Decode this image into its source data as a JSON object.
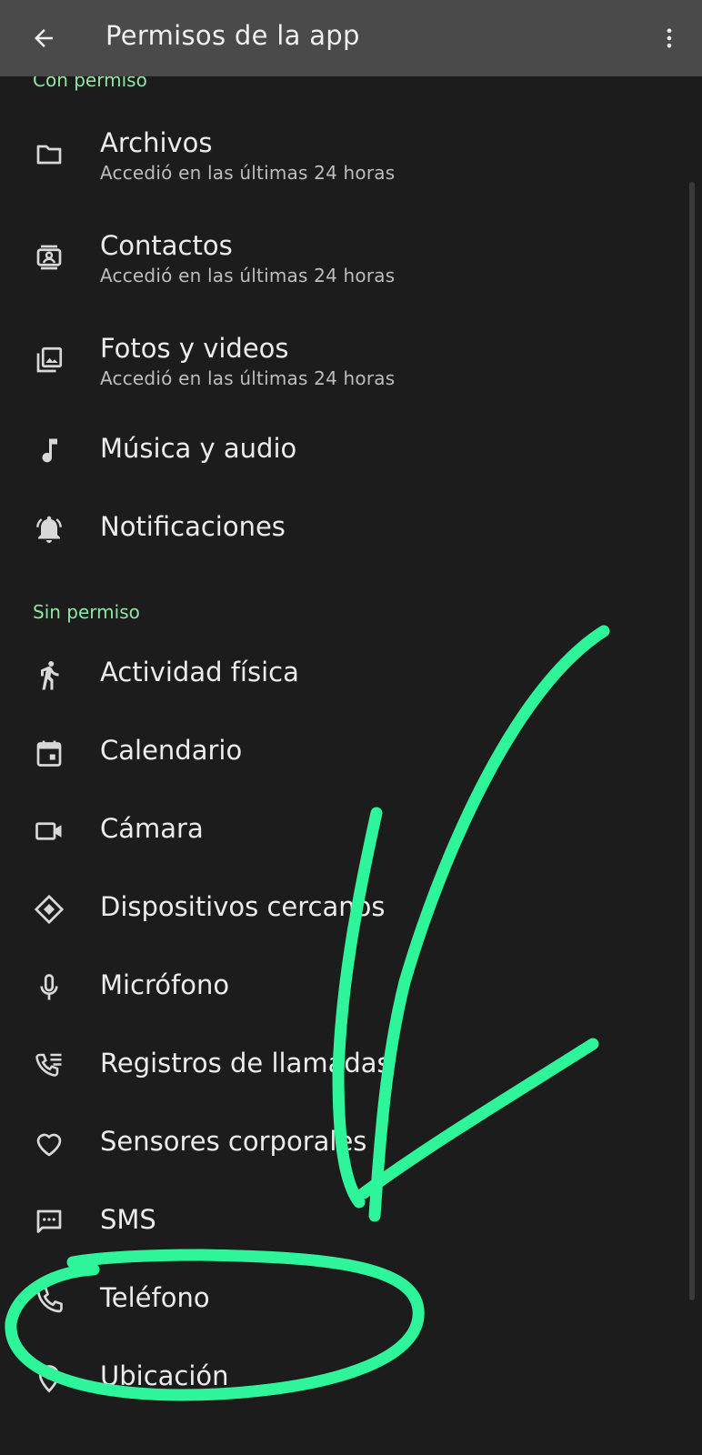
{
  "appbar": {
    "title": "Permisos de la app",
    "back_icon": "arrow-back-icon",
    "menu_icon": "more-vert-icon"
  },
  "sections": {
    "allowed_label": "Con permiso",
    "denied_label": "Sin permiso"
  },
  "allowed": [
    {
      "icon": "folder-icon",
      "title": "Archivos",
      "subtitle": "Accedió en las últimas 24 horas"
    },
    {
      "icon": "contacts-icon",
      "title": "Contactos",
      "subtitle": "Accedió en las últimas 24 horas"
    },
    {
      "icon": "photos-icon",
      "title": "Fotos y videos",
      "subtitle": "Accedió en las últimas 24 horas"
    },
    {
      "icon": "music-note-icon",
      "title": "Música y audio"
    },
    {
      "icon": "notification-bell-icon",
      "title": "Notificaciones"
    }
  ],
  "denied": [
    {
      "icon": "walking-icon",
      "title": "Actividad física"
    },
    {
      "icon": "calendar-icon",
      "title": "Calendario"
    },
    {
      "icon": "camera-icon",
      "title": "Cámara"
    },
    {
      "icon": "nearby-devices-icon",
      "title": "Dispositivos cercanos"
    },
    {
      "icon": "microphone-icon",
      "title": "Micrófono"
    },
    {
      "icon": "call-log-icon",
      "title": "Registros de llamadas"
    },
    {
      "icon": "heart-icon",
      "title": "Sensores corporales"
    },
    {
      "icon": "sms-icon",
      "title": "SMS"
    },
    {
      "icon": "phone-icon",
      "title": "Teléfono"
    },
    {
      "icon": "location-pin-icon",
      "title": "Ubicación"
    }
  ],
  "colors": {
    "background": "#1c1c1c",
    "appbar": "#4a4a4a",
    "section_label": "#8ee6a2",
    "annotation": "#2ef59a"
  }
}
